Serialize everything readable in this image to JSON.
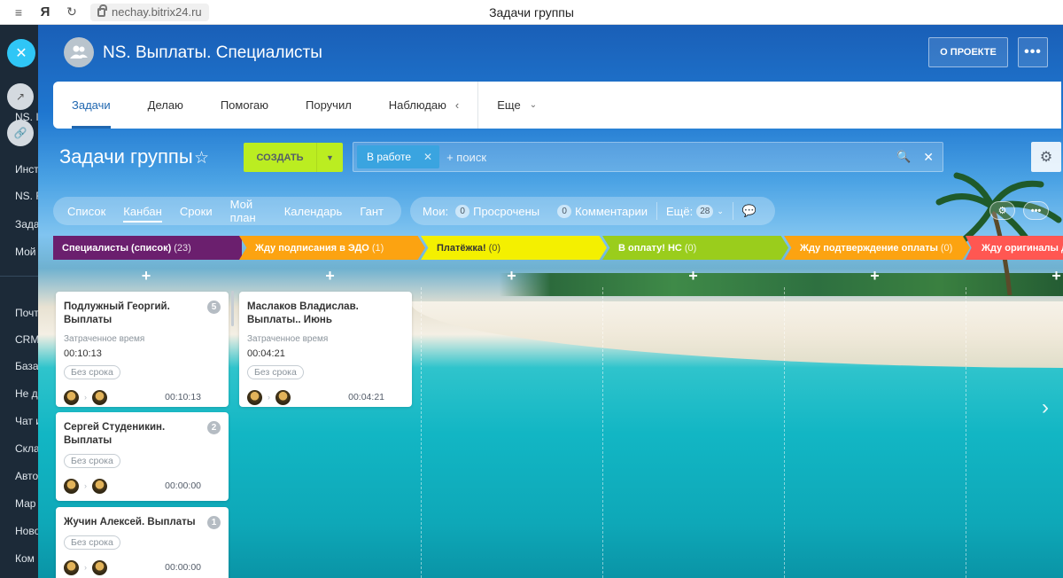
{
  "browser": {
    "url": "nechay.bitrix24.ru",
    "page_title": "Задачи группы",
    "logo": "Я"
  },
  "leftmenu": {
    "items": [
      "NS. I",
      "Инст",
      "NS. F",
      "Зада",
      "Мой",
      "Почт",
      "CRM",
      "База",
      "Не д",
      "Чат и",
      "Скла",
      "Авто",
      "Мар",
      "Ново",
      "Ком"
    ]
  },
  "header": {
    "group_title": "NS. Выплаты. Специалисты",
    "about_label": "О ПРОЕКТЕ",
    "more_label": "•••"
  },
  "tabs": [
    {
      "label": "Задачи",
      "active": true
    },
    {
      "label": "Делаю",
      "active": false
    },
    {
      "label": "Помогаю",
      "active": false
    },
    {
      "label": "Поручил",
      "active": false
    },
    {
      "label": "Наблюдаю",
      "active": false
    },
    {
      "label": "Еще",
      "active": false
    }
  ],
  "toolbar": {
    "title": "Задачи группы",
    "create_label": "СОЗДАТЬ",
    "filter_chip": "В работе",
    "search_placeholder": "+ поиск"
  },
  "views": [
    {
      "label": "Список",
      "active": false
    },
    {
      "label": "Канбан",
      "active": true
    },
    {
      "label": "Сроки",
      "active": false
    },
    {
      "label": "Мой план",
      "active": false
    },
    {
      "label": "Календарь",
      "active": false
    },
    {
      "label": "Гант",
      "active": false
    }
  ],
  "counters": {
    "my_label": "Мои:",
    "overdue_count": "0",
    "overdue_label": "Просрочены",
    "comments_count": "0",
    "comments_label": "Комментарии",
    "more_label": "Ещё:",
    "more_count": "28"
  },
  "columns": [
    {
      "title": "Специалисты (список)",
      "count": "(23)",
      "color": "#6b1f6e"
    },
    {
      "title": "Жду подписания в ЭДО",
      "count": "(1)",
      "color": "#fca311"
    },
    {
      "title": "Платёжка!",
      "count": "(0)",
      "color": "#f4f000",
      "text_color": "#333"
    },
    {
      "title": "В оплату! НС",
      "count": "(0)",
      "color": "#9acd1c"
    },
    {
      "title": "Жду подтверждение оплаты",
      "count": "(0)",
      "color": "#fca311"
    },
    {
      "title": "Жду оригиналы доку",
      "count": "",
      "color": "#ff5752"
    }
  ],
  "add_label": "+",
  "cards": [
    {
      "title": "Подлужный Георгий. Выплаты",
      "badge": "5",
      "time_label": "Затраченное время",
      "time": "00:10:13",
      "tag": "Без срока",
      "footer_time": "00:10:13"
    },
    {
      "title": "Сергей Студеникин. Выплаты",
      "badge": "2",
      "tag": "Без срока",
      "footer_time": "00:00:00"
    },
    {
      "title": "Жучин Алексей. Выплаты",
      "badge": "1",
      "tag": "Без срока",
      "footer_time": "00:00:00"
    },
    {
      "title": "Маслаков Владислав. Выплаты.. Июнь",
      "badge": "",
      "time_label": "Затраченное время",
      "time": "00:04:21",
      "tag": "Без срока",
      "footer_time": "00:04:21"
    }
  ],
  "icons": {
    "close": "close-icon",
    "share": "share-icon",
    "link": "link-icon",
    "star": "star-icon",
    "gear": "gear-icon",
    "search": "search-icon",
    "robot": "robot-icon",
    "chat": "chat-icon"
  }
}
